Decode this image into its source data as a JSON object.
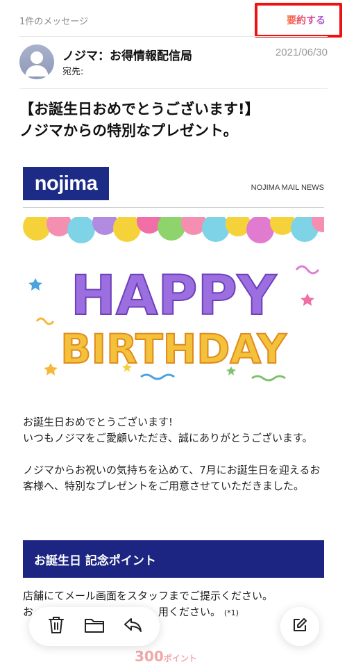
{
  "header": {
    "message_count": "1件のメッセージ",
    "summarize_label": "要約する",
    "summarize_icon": "summary-list-icon"
  },
  "sender": {
    "name": "ノジマ：お得情報配信局",
    "to_label": "宛先:",
    "date": "2021/06/30",
    "avatar_icon": "person-avatar-icon"
  },
  "subject": "【お誕生日おめでとうございます!】\nノジマからの特別なプレゼント。",
  "newsletter": {
    "logo_text": "nojima",
    "label": "NOJIMA MAIL NEWS"
  },
  "banner": {
    "line1": "HAPPY",
    "line2": "BIRTHDAY"
  },
  "body": {
    "paragraph1": "お誕生日おめでとうございます!\nいつもノジマをご愛顧いただき、誠にありがとうございます。",
    "paragraph2": "ノジマからお祝いの気持ちを込めて、7月にお誕生日を迎えるお客様へ、特別なプレゼントをご用意させていただきました。"
  },
  "points_section": {
    "header": "お誕生日 記念ポイント",
    "instruction": "店舗にてメール画面をスタッフまでご提示ください。",
    "partial_line_start": "お",
    "partial_line_end": "用ください。",
    "note": "(*1)",
    "value": "300",
    "unit": "ポイント"
  },
  "toolbar": {
    "delete_icon": "trash-icon",
    "folder_icon": "folder-icon",
    "reply_icon": "reply-icon",
    "compose_icon": "compose-icon"
  },
  "colors": {
    "brand_navy": "#1c2582",
    "highlight_red": "#ee1111",
    "summary_gradient_start": "#ff6a3d",
    "summary_gradient_end": "#9b5de5"
  }
}
